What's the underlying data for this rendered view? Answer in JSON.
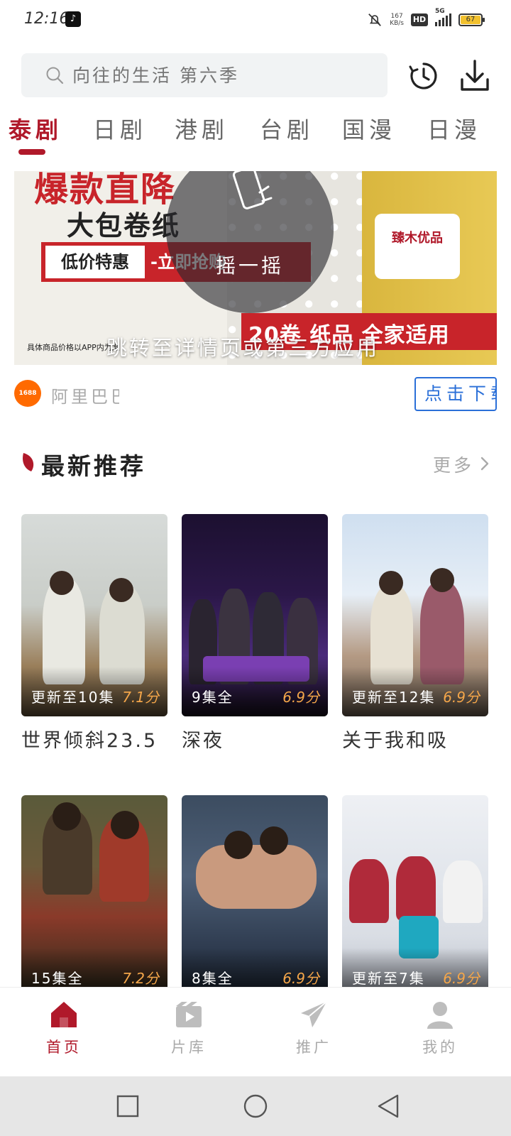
{
  "status_bar": {
    "time": "12:16",
    "app_badge": "♪",
    "speed_value": "167",
    "speed_unit": "KB/s",
    "hd": "HD",
    "network": "5G",
    "battery": "67"
  },
  "search": {
    "placeholder": "向往的生活 第六季"
  },
  "tabs": [
    {
      "label": "泰剧",
      "active": true
    },
    {
      "label": "日剧"
    },
    {
      "label": "港剧"
    },
    {
      "label": "台剧"
    },
    {
      "label": "国漫"
    },
    {
      "label": "日漫"
    }
  ],
  "ad": {
    "headline": "爆款直降",
    "product": "大包卷纸",
    "deal": "低价特惠",
    "deal_cta": "-立即抢购",
    "band": "20卷 纸品 全家适用",
    "brand": "臻木优品",
    "shake": "摇一摇",
    "jump": "跳转至详情页或第三方应用",
    "fine_print": "具体商品价格以APP内为准",
    "advertiser_logo": "1688",
    "advertiser": "阿里巴巴",
    "cta": "点击下载"
  },
  "section": {
    "title": "最新推荐",
    "more": "更多"
  },
  "cards": [
    {
      "title": "世界倾斜23.5",
      "episodes": "更新至10集",
      "score": "7.1分"
    },
    {
      "title": "深夜",
      "episodes": "9集全",
      "score": "6.9分"
    },
    {
      "title": "关于我和吸",
      "episodes": "更新至12集",
      "score": "6.9分"
    },
    {
      "title": "",
      "episodes": "15集全",
      "score": "7.2分"
    },
    {
      "title": "",
      "episodes": "8集全",
      "score": "6.9分"
    },
    {
      "title": "",
      "episodes": "更新至7集",
      "score": "6.9分"
    }
  ],
  "bottom_nav": [
    {
      "label": "首页",
      "icon": "home-icon",
      "active": true
    },
    {
      "label": "片库",
      "icon": "film-library-icon"
    },
    {
      "label": "推广",
      "icon": "paper-plane-icon"
    },
    {
      "label": "我的",
      "icon": "profile-icon"
    }
  ],
  "colors": {
    "accent": "#b0192a",
    "score": "#f4a64a",
    "cta_blue": "#2a6fd8"
  }
}
